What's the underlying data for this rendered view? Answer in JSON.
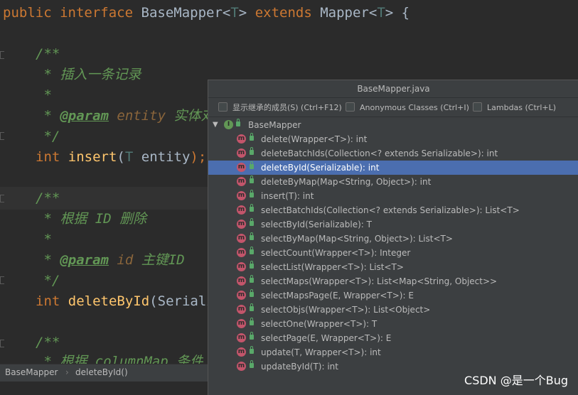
{
  "editor": {
    "line1": {
      "kw1": "public",
      "kw2": "interface",
      "name": "BaseMapper",
      "lt": "<",
      "tparam": "T",
      "gt": ">",
      "kw3": "extends",
      "parent": "Mapper",
      "lt2": "<",
      "tparam2": "T",
      "gt2": ">",
      "brace": " {"
    },
    "doc_open": "/**",
    "doc1_star": " * ",
    "doc1_text": "插入一条记录",
    "doc_star": " *",
    "doc1_param_star": " * ",
    "doc1_param_tag": "@param",
    "doc1_param_name": "entity",
    "doc1_param_desc": "实体对",
    "doc_close": " */",
    "insert": {
      "type": "int",
      "name": "insert",
      "open": "(",
      "ptype": "T",
      "pname": " entity",
      "close": ");"
    },
    "doc2_open": "/**",
    "doc2_star": " * ",
    "doc2_text": "根据 ID 删除",
    "doc2_param_star": " * ",
    "doc2_param_tag": "@param",
    "doc2_param_name": "id",
    "doc2_param_desc": "主键ID",
    "delete": {
      "type": "int",
      "name": "deleteById",
      "open": "(",
      "rest": "Seriali"
    },
    "doc3_open": "/**",
    "doc3_partial": " * 根据 columnMap 条件"
  },
  "breadcrumb": {
    "item1": "BaseMapper",
    "sep": "›",
    "item2": "deleteById()"
  },
  "popup": {
    "title": "BaseMapper.java",
    "options": [
      {
        "label": "显示继承的成员(S) (Ctrl+F12)"
      },
      {
        "label": "Anonymous Classes (Ctrl+I)"
      },
      {
        "label": "Lambdas (Ctrl+L)"
      }
    ],
    "root_label": "BaseMapper",
    "root_icon": "interface-icon",
    "members": [
      {
        "label": "delete(Wrapper<T>): int"
      },
      {
        "label": "deleteBatchIds(Collection<? extends Serializable>): int"
      },
      {
        "label": "deleteById(Serializable): int",
        "selected": true
      },
      {
        "label": "deleteByMap(Map<String, Object>): int"
      },
      {
        "label": "insert(T): int"
      },
      {
        "label": "selectBatchIds(Collection<? extends Serializable>): List<T>"
      },
      {
        "label": "selectById(Serializable): T"
      },
      {
        "label": "selectByMap(Map<String, Object>): List<T>"
      },
      {
        "label": "selectCount(Wrapper<T>): Integer"
      },
      {
        "label": "selectList(Wrapper<T>): List<T>"
      },
      {
        "label": "selectMaps(Wrapper<T>): List<Map<String, Object>>"
      },
      {
        "label": "selectMapsPage(E, Wrapper<T>): E"
      },
      {
        "label": "selectObjs(Wrapper<T>): List<Object>"
      },
      {
        "label": "selectOne(Wrapper<T>): T"
      },
      {
        "label": "selectPage(E, Wrapper<T>): E"
      },
      {
        "label": "update(T, Wrapper<T>): int"
      },
      {
        "label": "updateById(T): int"
      }
    ]
  },
  "watermark": "CSDN @是一个Bug",
  "colors": {
    "selection": "#4b6eaf",
    "keyword": "#cc7832",
    "comment": "#629755",
    "method": "#ffc66d"
  }
}
